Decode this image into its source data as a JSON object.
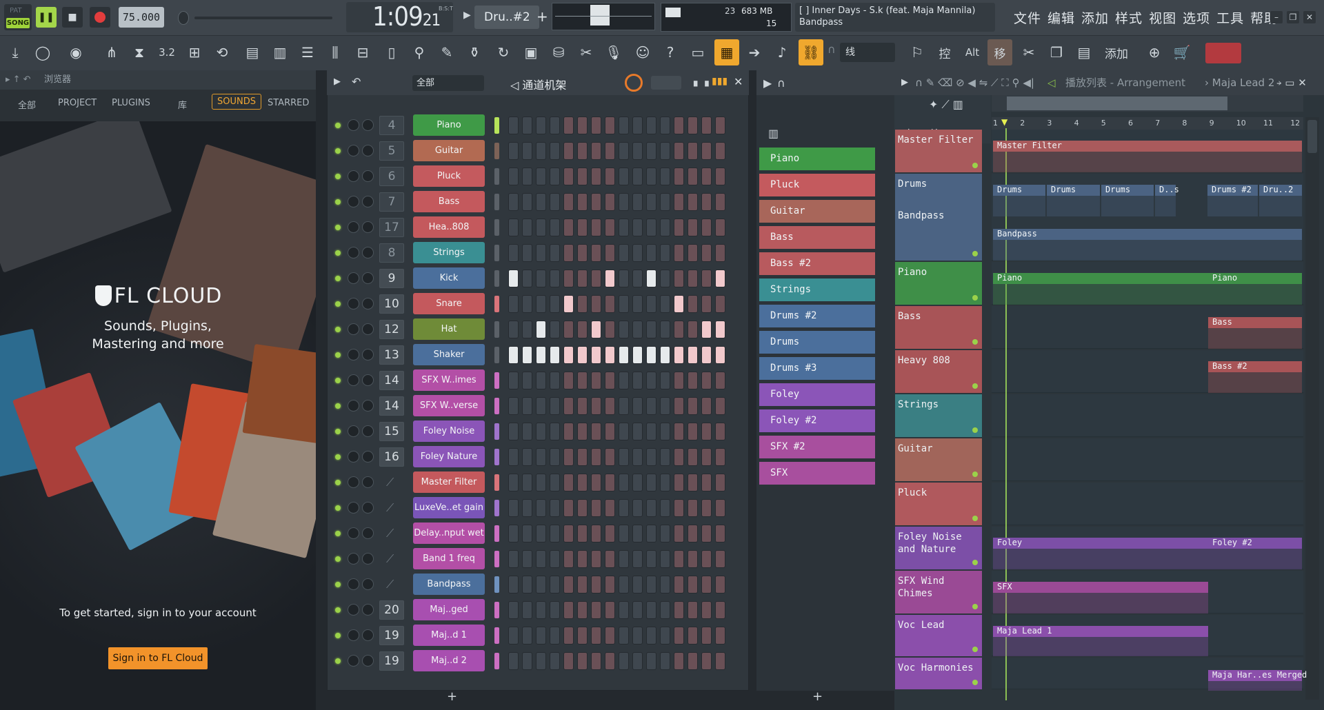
{
  "toolbar": {
    "mode_pat": "PAT",
    "mode_song": "SONG",
    "tempo": "75.000",
    "time_main": "1:09",
    "time_sub": "21",
    "time_label": "B:S:T",
    "pattern": "Dru..#2",
    "cpu_value": "23",
    "mem_value": "683 MB",
    "poly_value": "15",
    "hint_line1": "[  ] Inner Days - S.k (feat. Maja Mannila)",
    "hint_line2": "Bandpass",
    "menu": [
      "文件",
      "编辑",
      "添加",
      "样式",
      "视图",
      "选项",
      "工具",
      "帮助"
    ],
    "snap_label": "线",
    "alt_label": "Alt",
    "add_label": "添加"
  },
  "browser": {
    "title": "浏览器",
    "tabs": [
      "全部",
      "PROJECT",
      "PLUGINS",
      "库",
      "SOUNDS",
      "STARRED"
    ],
    "cloud_title": "FL CLOUD",
    "cloud_sub1": "Sounds, Plugins,",
    "cloud_sub2": "Mastering and more",
    "hint": "To get started, sign in to your account",
    "signin": "Sign in to FL Cloud"
  },
  "rack": {
    "filter": "全部",
    "title": "通道机架",
    "rows": [
      {
        "num": "4",
        "name": "Piano",
        "color": "#3f9a47",
        "sel": "#b7e35a"
      },
      {
        "num": "5",
        "name": "Guitar",
        "color": "#b26a52",
        "sel": "#7d6257"
      },
      {
        "num": "6",
        "name": "Pluck",
        "color": "#c45a5e",
        "sel": "#5b6168"
      },
      {
        "num": "7",
        "name": "Bass",
        "color": "#c4595d",
        "sel": "#5b6168"
      },
      {
        "num": "17",
        "name": "Hea..808",
        "color": "#c4595d",
        "sel": "#5b6168"
      },
      {
        "num": "8",
        "name": "Strings",
        "color": "#3a8f93",
        "sel": "#5b6168"
      },
      {
        "num": "9",
        "name": "Kick",
        "color": "#4b6f9c",
        "sel": "#5b6168"
      },
      {
        "num": "10",
        "name": "Snare",
        "color": "#c4595d",
        "sel": "#d9747a"
      },
      {
        "num": "12",
        "name": "Hat",
        "color": "#6f8b38",
        "sel": "#5b6168"
      },
      {
        "num": "13",
        "name": "Shaker",
        "color": "#4b6f9c",
        "sel": "#5b6168"
      },
      {
        "num": "14",
        "name": "SFX W..imes",
        "color": "#b34fa6",
        "sel": "#cc6fc2"
      },
      {
        "num": "14",
        "name": "SFX W..verse",
        "color": "#b34fa6",
        "sel": "#cc6fc2"
      },
      {
        "num": "15",
        "name": "Foley Noise",
        "color": "#8b55b8",
        "sel": "#9f74cc"
      },
      {
        "num": "16",
        "name": "Foley Nature",
        "color": "#8b55b8",
        "sel": "#9f74cc"
      },
      {
        "num": "",
        "name": "Master Filter",
        "color": "#c4595d",
        "sel": "#d9747a"
      },
      {
        "num": "",
        "name": "LuxeVe..et gain",
        "color": "#7a55b8",
        "sel": "#9f74cc"
      },
      {
        "num": "",
        "name": "Delay..nput wet",
        "color": "#b34fa6",
        "sel": "#cc6fc2"
      },
      {
        "num": "",
        "name": "Band 1 freq",
        "color": "#b34fa6",
        "sel": "#cc6fc2"
      },
      {
        "num": "",
        "name": "Bandpass",
        "color": "#4b6f9c",
        "sel": "#6f92bf"
      },
      {
        "num": "20",
        "name": "Maj..ged",
        "color": "#a84fb0",
        "sel": "#cc6fc2"
      },
      {
        "num": "19",
        "name": "Maj..d 1",
        "color": "#a84fb0",
        "sel": "#cc6fc2"
      },
      {
        "num": "19",
        "name": "Maj..d 2",
        "color": "#a84fb0",
        "sel": "#cc6fc2"
      }
    ],
    "add_label": "+"
  },
  "picker": [
    {
      "name": "Piano",
      "color": "#3f9a47"
    },
    {
      "name": "Pluck",
      "color": "#c45a5e"
    },
    {
      "name": "Guitar",
      "color": "#a8665a"
    },
    {
      "name": "Bass",
      "color": "#b85a5e"
    },
    {
      "name": "Bass #2",
      "color": "#b85a5e"
    },
    {
      "name": "Strings",
      "color": "#3a8f93"
    },
    {
      "name": "Drums #2",
      "color": "#4b6f9c"
    },
    {
      "name": "Drums",
      "color": "#4b6f9c"
    },
    {
      "name": "Drums #3",
      "color": "#4b6f9c"
    },
    {
      "name": "Foley",
      "color": "#8b55b8"
    },
    {
      "name": "Foley #2",
      "color": "#8b55b8"
    },
    {
      "name": "SFX #2",
      "color": "#a84f9e"
    },
    {
      "name": "SFX",
      "color": "#a84f9e"
    }
  ],
  "playlist": {
    "title": "播放列表 - Arrangement",
    "crumb": "Maja Lead 2",
    "ruler": [
      "1",
      "2",
      "3",
      "4",
      "5",
      "6",
      "7",
      "8",
      "9",
      "10",
      "11",
      "12"
    ],
    "tracks": [
      {
        "name": "Master Filter",
        "color": "#a95a5c"
      },
      {
        "name": "Drums",
        "sub": "Bandpass",
        "color": "#4b6383"
      },
      {
        "name": "Piano",
        "color": "#3f8f48"
      },
      {
        "name": "Bass",
        "color": "#a85457"
      },
      {
        "name": "Heavy 808",
        "color": "#a85457"
      },
      {
        "name": "Strings",
        "color": "#3a7f83"
      },
      {
        "name": "Guitar",
        "color": "#a1655a"
      },
      {
        "name": "Pluck",
        "color": "#b0595d"
      },
      {
        "name": "Foley Noise and Nature",
        "color": "#7c4fa7"
      },
      {
        "name": "SFX Wind Chimes",
        "color": "#9a4a95"
      },
      {
        "name": "Voc Lead",
        "color": "#8b4fab"
      },
      {
        "name": "Voc Harmonies",
        "color": "#8b4fab"
      }
    ],
    "clips": {
      "master_filter": "Master Filter",
      "drums": [
        "Drums",
        "Drums",
        "Drums",
        "D..s",
        "Drums #2",
        "Dru..2"
      ],
      "bandpass": "Bandpass",
      "piano": [
        "Piano",
        "Piano"
      ],
      "bass": "Bass",
      "bass2": "Bass #2",
      "foley": "Foley",
      "foley2": "Foley #2",
      "sfx": "SFX",
      "lead": "Maja Lead 1",
      "harm": "Maja Har..es Merged"
    }
  }
}
